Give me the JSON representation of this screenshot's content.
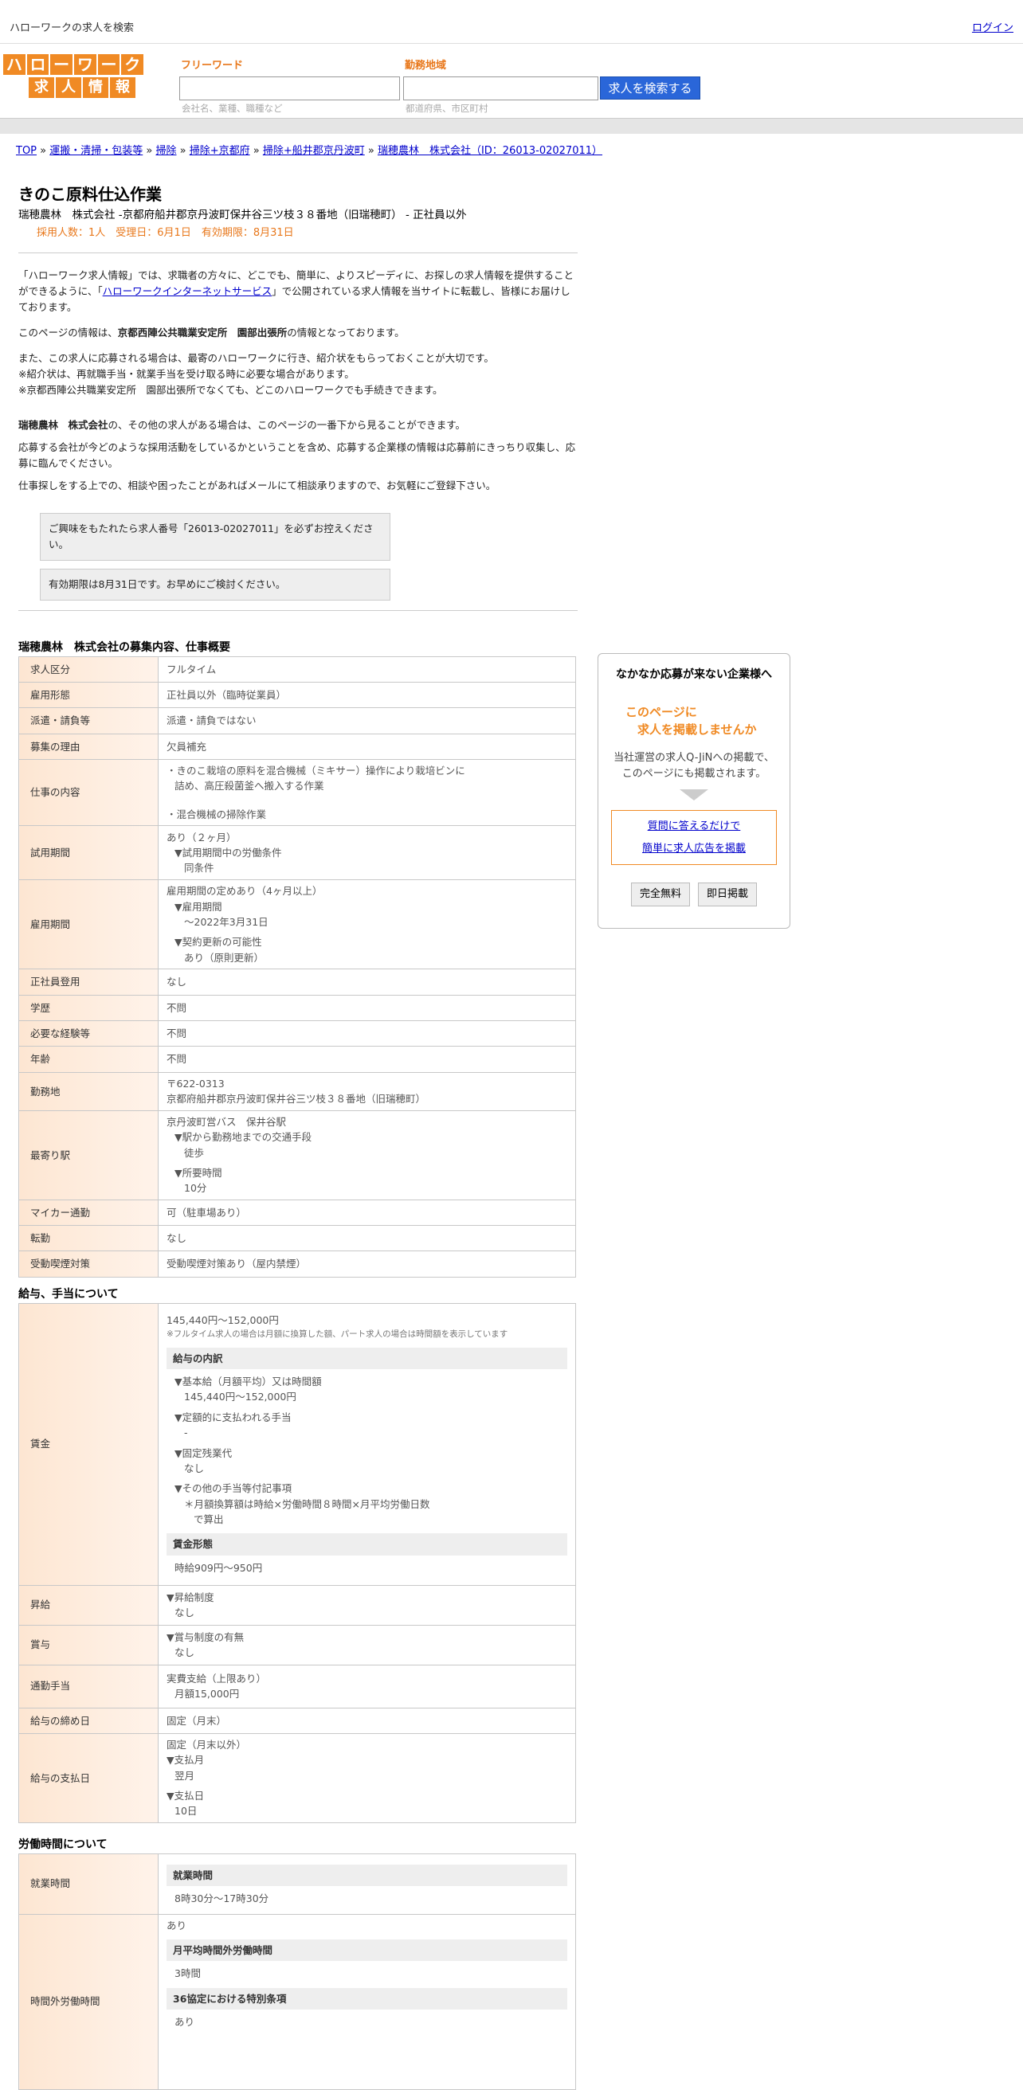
{
  "header": {
    "title": "ハローワークの求人を検索",
    "login": "ログイン"
  },
  "logo": {
    "row1": [
      "ハ",
      "ロ",
      "ー",
      "ワ",
      "ー",
      "ク"
    ],
    "row2": [
      "求",
      "人",
      "情",
      "報"
    ]
  },
  "search": {
    "free_label": "フリーワード",
    "free_placeholder": "会社名、業種、職種など",
    "area_label": "勤務地域",
    "area_placeholder": "都道府県、市区町村",
    "button": "求人を検索する"
  },
  "breadcrumb": [
    {
      "text": "TOP",
      "link": true
    },
    {
      "text": "運搬・清掃・包装等",
      "link": true
    },
    {
      "text": "掃除",
      "link": true
    },
    {
      "text": "掃除+京都府",
      "link": true
    },
    {
      "text": "掃除+船井郡京丹波町",
      "link": true
    },
    {
      "text": "瑞穂農林　株式会社（ID：26013-02027011）",
      "link": true
    }
  ],
  "job": {
    "title": "きのこ原料仕込作業",
    "subtitle": "瑞穂農林　株式会社 -京都府船井郡京丹波町保井谷三ツ枝３８番地（旧瑞穂町） - 正社員以外",
    "meta": "採用人数：1人　受理日：6月1日　有効期限：8月31日"
  },
  "intro": {
    "p1a": "「ハローワーク求人情報」では、求職者の方々に、どこでも、簡単に、よりスピーディに、お探しの求人情報を提供することができるように、「",
    "p1link": "ハローワークインターネットサービス",
    "p1b": "」で公開されている求人情報を当サイトに転載し、皆様にお届けしております。",
    "p2a": "このページの情報は、",
    "p2b": "京都西陣公共職業安定所　園部出張所",
    "p2c": "の情報となっております。",
    "p3l1": "また、この求人に応募される場合は、最寄のハローワークに行き、紹介状をもらっておくことが大切です。",
    "p3l2": "※紹介状は、再就職手当・就業手当を受け取る時に必要な場合があります。",
    "p3l3": "※京都西陣公共職業安定所　園部出張所でなくても、どこのハローワークでも手続きできます。",
    "p4a": "瑞穂農林　株式会社",
    "p4b": "の、その他の求人がある場合は、このページの一番下から見ることができます。",
    "p5": "応募する会社が今どのような採用活動をしているかということを含め、応募する企業様の情報は応募前にきっちり収集し、応募に臨んでください。",
    "p6": "仕事探しをする上での、相談や困ったことがあればメールにて相談承りますので、お気軽にご登録下さい。",
    "notice1": "ご興味をもたれたら求人番号「26013-02027011」を必ずお控えください。",
    "notice2": "有効期限は8月31日です。お早めにご検討ください。"
  },
  "sec1": {
    "title": "瑞穂農林　株式会社の募集内容、仕事概要",
    "rows": {
      "r1": {
        "k": "求人区分",
        "v": "フルタイム"
      },
      "r2": {
        "k": "雇用形態",
        "v": "正社員以外（臨時従業員）"
      },
      "r3": {
        "k": "派遣・請負等",
        "v": "派遣・請負ではない"
      },
      "r4": {
        "k": "募集の理由",
        "v": "欠員補充"
      },
      "r5": {
        "k": "仕事の内容",
        "l1": "・きのこ栽培の原料を混合機械（ミキサー）操作により栽培ビンに",
        "l2": "詰め、高圧殺菌釜へ搬入する作業",
        "l3": "・混合機械の掃除作業"
      },
      "r6": {
        "k": "試用期間",
        "l1": "あり（２ヶ月）",
        "l2": "▼試用期間中の労働条件",
        "l3": "同条件"
      },
      "r7": {
        "k": "雇用期間",
        "l1": "雇用期間の定めあり（4ヶ月以上）",
        "l2": "▼雇用期間",
        "l3": "〜2022年3月31日",
        "l4": "▼契約更新の可能性",
        "l5": "あり（原則更新）"
      },
      "r8": {
        "k": "正社員登用",
        "v": "なし"
      },
      "r9": {
        "k": "学歴",
        "v": "不問"
      },
      "r10": {
        "k": "必要な経験等",
        "v": "不問"
      },
      "r11": {
        "k": "年齢",
        "v": "不問"
      },
      "r12": {
        "k": "勤務地",
        "l1": "〒622-0313",
        "l2": "京都府船井郡京丹波町保井谷三ツ枝３８番地（旧瑞穂町）"
      },
      "r13": {
        "k": "最寄り駅",
        "l1": "京丹波町営バス　保井谷駅",
        "l2": "▼駅から勤務地までの交通手段",
        "l3": "徒歩",
        "l4": "▼所要時間",
        "l5": "10分"
      },
      "r14": {
        "k": "マイカー通勤",
        "v": "可（駐車場あり）"
      },
      "r15": {
        "k": "転勤",
        "v": "なし"
      },
      "r16": {
        "k": "受動喫煙対策",
        "v": "受動喫煙対策あり（屋内禁煙）"
      }
    }
  },
  "sec2": {
    "title": "給与、手当について",
    "wage": {
      "k": "賃金",
      "l1": "145,440円〜152,000円",
      "note": "※フルタイム求人の場合は月額に換算した額、パート求人の場合は時間額を表示しています",
      "h1": "給与の内訳",
      "b1": "▼基本給（月額平均）又は時間額",
      "b1v": "145,440円〜152,000円",
      "b2": "▼定額的に支払われる手当",
      "b2v": "-",
      "b3": "▼固定残業代",
      "b3v": "なし",
      "b4": "▼その他の手当等付記事項",
      "b4v1": "＊月額換算額は時給×労働時間８時間×月平均労働日数",
      "b4v2": "で算出",
      "h2": "賃金形態",
      "h2v": "時給909円〜950円"
    },
    "raise": {
      "k": "昇給",
      "l1": "▼昇給制度",
      "l2": "なし"
    },
    "bonus": {
      "k": "賞与",
      "l1": "▼賞与制度の有無",
      "l2": "なし"
    },
    "commute": {
      "k": "通勤手当",
      "l1": "実費支給（上限あり）",
      "l2": "月額15,000円"
    },
    "cutoff": {
      "k": "給与の締め日",
      "v": "固定（月末）"
    },
    "payday": {
      "k": "給与の支払日",
      "l1": "固定（月末以外）",
      "l2": "▼支払月",
      "l3": "翌月",
      "l4": "▼支払日",
      "l5": "10日"
    }
  },
  "sec3": {
    "title": "労働時間について",
    "hours": {
      "k": "就業時間",
      "h": "就業時間",
      "v": "8時30分〜17時30分"
    },
    "overtime": {
      "k": "時間外労働時間",
      "l1": "あり",
      "h1": "月平均時間外労働時間",
      "v1": "3時間",
      "h2": "36協定における特別条項",
      "v2": "あり"
    }
  },
  "side": {
    "title": "なかなか応募が来ない企業様へ",
    "promo1": "このページに",
    "promo2": "　求人を掲載しませんか",
    "desc1": "当社運営の求人Q-JiNへの掲載で、",
    "desc2": "このページにも掲載されます。",
    "link1": "質問に答えるだけで",
    "link2": "簡単に求人広告を掲載",
    "btn1": "完全無料",
    "btn2": "即日掲載"
  },
  "colors": {
    "accent": "#f08a24",
    "search_button": "#2a66d9",
    "link": "#0000cc"
  }
}
